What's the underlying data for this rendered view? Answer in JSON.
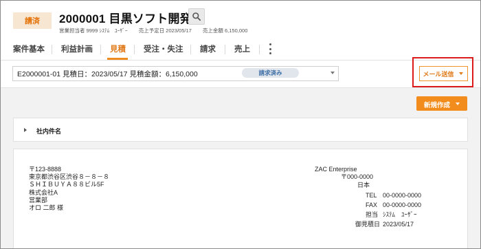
{
  "header": {
    "status_badge": "請済",
    "title": "2000001 目黒ソフト開発",
    "sales_rep": "営業担当者 9999 ｼｽﾃﾑ　ﾕｰｻﾞｰ",
    "sales_date": "売上予定日 2023/05/17",
    "sales_amount": "売上金額 6,150,000"
  },
  "tabs": [
    {
      "label": "案件基本"
    },
    {
      "label": "利益計画"
    },
    {
      "label": "見積",
      "active": true
    },
    {
      "label": "受注・失注"
    },
    {
      "label": "請求"
    },
    {
      "label": "売上"
    }
  ],
  "estimate_select": {
    "value": "E2000001-01 見積日：2023/05/17 見積金額：6,150,000",
    "status": "請求済み"
  },
  "mail_send_label": "メール送信",
  "new_create_label": "新規作成",
  "internal_name_label": "社内件名",
  "document": {
    "recipient": [
      "〒123-8888",
      "東京都渋谷区渋谷８－８－８",
      "ＳＨＩＢＵＹＡ８８ビル5F",
      "株式会社A",
      "営業部",
      "オロ 二郎 様"
    ],
    "company_name": "ZAC Enterprise",
    "postal": "〒000-0000",
    "country": "日本",
    "tel_label": "TEL",
    "tel": "00-0000-0000",
    "fax_label": "FAX",
    "fax": "00-0000-0000",
    "person_label": "担当",
    "person": "ｼｽﾃﾑ　ﾕｰｻﾞｰ",
    "date_label": "御見積日",
    "date": "2023/05/17"
  },
  "colors": {
    "accent": "#f28c1c",
    "highlight": "#dd1a1a",
    "status_pill_bg": "#e1e6ec"
  }
}
